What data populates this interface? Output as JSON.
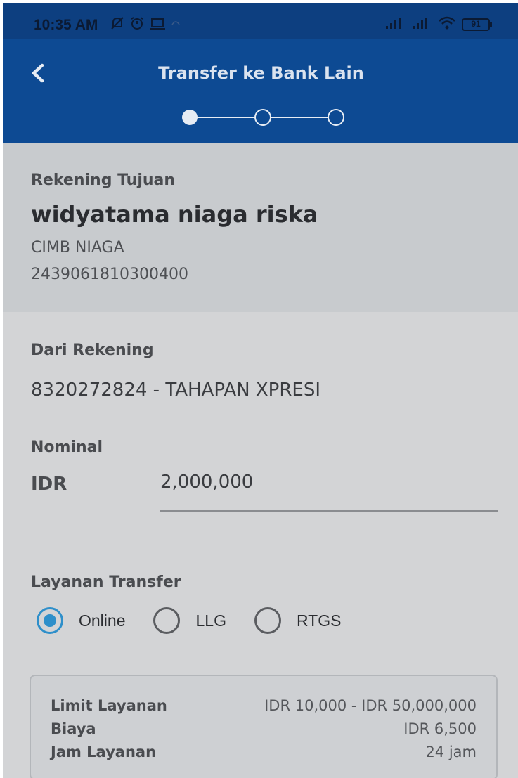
{
  "status_bar": {
    "time": "10:35 AM",
    "battery": "91"
  },
  "header": {
    "title": "Transfer ke Bank Lain",
    "steps_total": 3,
    "current_step": 1
  },
  "recipient": {
    "label": "Rekening Tujuan",
    "name": "widyatama niaga riska",
    "bank": "CIMB NIAGA",
    "account_number": "2439061810300400"
  },
  "form": {
    "from_label": "Dari Rekening",
    "from_value": "8320272824 - TAHAPAN XPRESI",
    "nominal_label": "Nominal",
    "currency": "IDR",
    "amount": "2,000,000",
    "service_label": "Layanan Transfer",
    "service_options": [
      {
        "label": "Online",
        "selected": true
      },
      {
        "label": "LLG",
        "selected": false
      },
      {
        "label": "RTGS",
        "selected": false
      }
    ]
  },
  "service_info": {
    "limit_label": "Limit Layanan",
    "limit_value": "IDR 10,000 - IDR 50,000,000",
    "fee_label": "Biaya",
    "fee_value": "IDR 6,500",
    "hours_label": "Jam Layanan",
    "hours_value": "24 jam"
  },
  "colors": {
    "header": "#0d4a93",
    "status_bar": "#0d3f80",
    "accent": "#2e8fca",
    "background": "#d3d4d6"
  }
}
